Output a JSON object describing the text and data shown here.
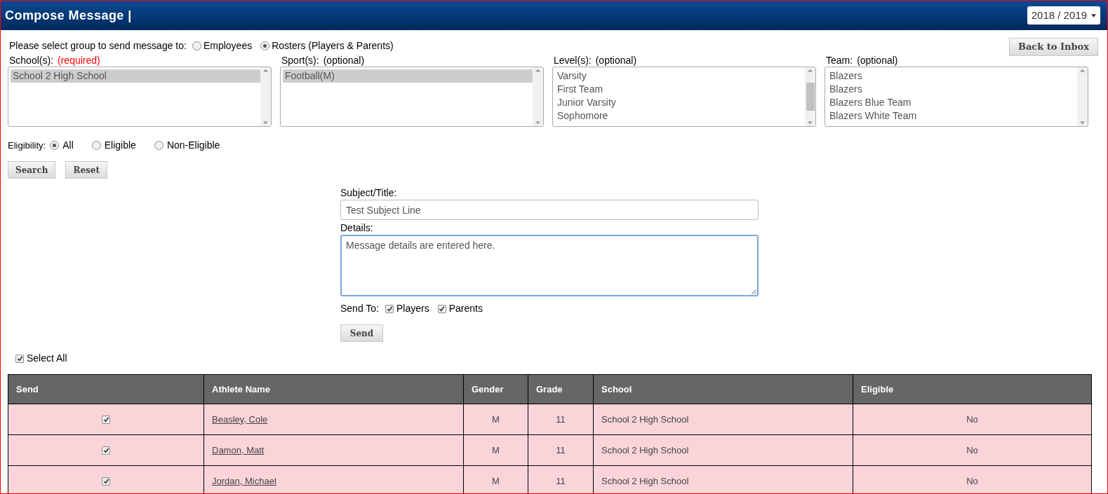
{
  "header": {
    "title": "Compose Message |",
    "year_select": "2018 / 2019"
  },
  "group": {
    "label": "Please select group to send message to:",
    "options": [
      {
        "label": "Employees",
        "selected": false
      },
      {
        "label": "Rosters (Players & Parents)",
        "selected": true
      }
    ]
  },
  "back_button": "Back to Inbox",
  "lists": [
    {
      "label": "School(s):",
      "note": "(required)",
      "required": true,
      "scroll_thumb": false,
      "items": [
        {
          "label": "School 2 High School",
          "selected": true
        }
      ]
    },
    {
      "label": "Sport(s):",
      "note": "(optional)",
      "required": false,
      "scroll_thumb": false,
      "items": [
        {
          "label": "Football(M)",
          "selected": true
        }
      ]
    },
    {
      "label": "Level(s):",
      "note": "(optional)",
      "required": false,
      "scroll_thumb": true,
      "items": [
        {
          "label": "Varsity",
          "selected": false
        },
        {
          "label": "First Team",
          "selected": false
        },
        {
          "label": "Junior Varsity",
          "selected": false
        },
        {
          "label": "Sophomore",
          "selected": false
        }
      ]
    },
    {
      "label": "Team:",
      "note": "(optional)",
      "required": false,
      "scroll_thumb": false,
      "items": [
        {
          "label": "Blazers",
          "selected": false
        },
        {
          "label": "Blazers",
          "selected": false
        },
        {
          "label": "Blazers Blue Team",
          "selected": false
        },
        {
          "label": "Blazers White Team",
          "selected": false
        }
      ]
    }
  ],
  "eligibility": {
    "label": "Eligibility:",
    "options": [
      {
        "label": "All",
        "selected": true
      },
      {
        "label": "Eligible",
        "selected": false
      },
      {
        "label": "Non-Eligible",
        "selected": false
      }
    ]
  },
  "filter_buttons": [
    "Search",
    "Reset"
  ],
  "compose": {
    "subject_label": "Subject/Title:",
    "subject": "Test Subject Line",
    "details_label": "Details:",
    "details": "Message details are entered here.",
    "send_to_label": "Send To:",
    "send_to": [
      {
        "label": "Players",
        "checked": true
      },
      {
        "label": "Parents",
        "checked": true
      }
    ],
    "send_button": "Send"
  },
  "select_all": {
    "label": "Select All",
    "checked": true
  },
  "table": {
    "columns": [
      "Send",
      "Athlete Name",
      "Gender",
      "Grade",
      "School",
      "Eligible"
    ],
    "rows": [
      {
        "checked": true,
        "name": "Beasley, Cole",
        "gender": "M",
        "grade": "11",
        "school": "School 2 High School",
        "eligible": "No"
      },
      {
        "checked": true,
        "name": "Damon, Matt",
        "gender": "M",
        "grade": "11",
        "school": "School 2 High School",
        "eligible": "No"
      },
      {
        "checked": true,
        "name": "Jordan, Michael",
        "gender": "M",
        "grade": "11",
        "school": "School 2 High School",
        "eligible": "No"
      }
    ]
  }
}
